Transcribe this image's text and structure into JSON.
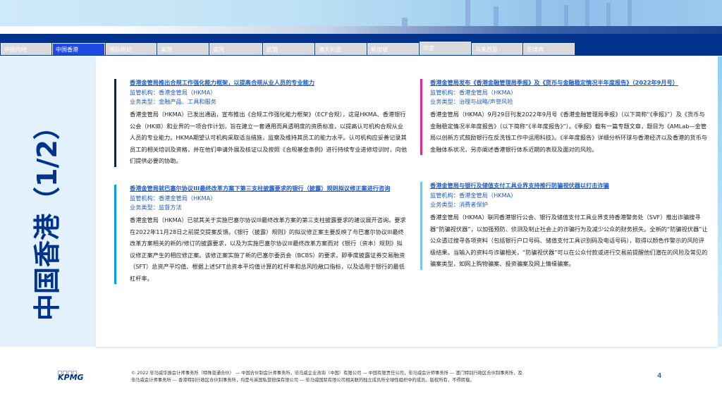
{
  "tabs": [
    {
      "label": "中国内地"
    },
    {
      "label": "中国香港",
      "active": true
    },
    {
      "label": "国际组织"
    },
    {
      "label": "美国"
    },
    {
      "label": "英国"
    },
    {
      "label": "欧盟"
    },
    {
      "label": "澳大利亚"
    },
    {
      "label": "新加坡"
    },
    {
      "label": "印度"
    },
    {
      "label": "马来西亚"
    },
    {
      "label": "菲律宾"
    }
  ],
  "page_title": "中国香港（1/2）",
  "articles": [
    {
      "title": "香港金管局推出合规工作强化能力框架，以提高合规从业人员的专业能力",
      "regulator": "监管机构：香港金管局（HKMA）",
      "type": "业务类型：金融产品、工具和服务",
      "body": "香港金管局（HKMA）已发出通函，宣布推出《合规工作强化能力框架》（ECF合规），这是HKMA、香港银行公会（HKIB）和业界的一项合作计划，旨在建立一套通用而具透明度的资质标准，以提高认可机构合规从业人员的专业能力。HKMA期望认可机构采取适当措施，监察及维持其员工的能力水平。认可机构应妥善记录其员工的相关培训及资格，并在他们申请外展及核证以及按照《合规基金条例》进行持续专业进修培训时，向他们提供必要的协助。",
      "color": "#0c233f"
    },
    {
      "title": "香港金管局就巴塞尔协议III最终改革方案下第三支柱披露要求的银行（披露）规则拟议修正案进行咨询",
      "regulator": "监管机构：香港金管局（HKMA）",
      "type": "业务类型：监督方法",
      "body": "香港金管局（HKMA）已就其关于实施巴塞尔协议III最终改革方案的第三支柱披露要求的建议展开咨询。要求在2022年11月28日之前提交提案反馈。《银行（披露）规则》的拟议修正案主要反映了与巴塞尔协议III最终改革方案相关的新的/修订的披露要求，以及为实施巴塞尔协议III最终改革方案而对《银行（资本）规则》拟议修正案产生的相应修正案。该修正案实施了新的巴塞尔委员会（BCBS）的要求，即季度披露证券交易融资（SFT）总资产平均值、根据上述SFT总资本平均值计算的杠杆率和总风险敞口指标，以及适用于银行的最低杠杆率。",
      "color": "#00a3e0"
    },
    {
      "title": "香港金管局发布《香港金融管理局季报》及《货币与金融稳定情况半年度报告》（2022年9月号）",
      "regulator": "监管机构：香港金管局（HKMA）",
      "type": "业务类型：治理与战略/声誉风险",
      "body": "香港金管局（HKMA）9月29日刊发2022年9月号《香港金融管理局季报》（以下简称“《季报》”）及《货币与金融稳定情况半年度报告》（以下简称“《半年度报告》”）。《季报》载有一篇专题文章，题目为《AMLab—金管局以创新方式鼓励银行在反洗钱工作中运用科技》。《半年度报告》详细分析环球与香港经济以及香港的货币与金融体系状况，另亦阐述香港银行体系近期的表现及面对的风险。",
      "color": "#e6278a"
    },
    {
      "title": "香港金管局与银行及储值支付工具业界支持推行防骗视伏器以打击诈骗",
      "regulator": "监管机构：香港金管局（HKMA）",
      "type": "业务类型：消费者保护",
      "body": "香港金管局（HKMA）联同香港银行公会、银行及储值支付工具业界支持香港警务处（SVF）推出诈骗搜寻器“防骗视伏器”，以加强预防、侦测及制止社会上的诈骗行为及减少公众的财务损失。全新的“防骗视伏器”让公众透过搜寻各项资料（包括银行户口号码、储值支付工具识别码及电话号码），取得以颜色作警示的风险评级结果。当输入的资料与诈骗相关，“防骗视伏器”可以在公众付款或进行交易前提醒他们潜在的风险及常见的骗案类型，如网上购物骗案、投资骗案及网上情缘骗案。",
      "color": "#7cc4ee"
    }
  ],
  "footer": {
    "line1": "© 2022 毕马威华振会计师事务所（特殊普通合伙） — 中国合伙制会计师事务所，毕马威企业咨询（中国）有限公司 — 中国有限责任公司，毕马威会计师事务所 — 澳门特别行政区合伙制事务所，及",
    "line2": "毕马威会计师事务所 — 香港特别行政区合伙制事务所，均是与英国私营担保有限公司 — 毕马威国际有限公司相关联的独立成员所全球性组织中的成员。版权所有，不得转载。",
    "logo": "KPMG",
    "page": "4"
  }
}
